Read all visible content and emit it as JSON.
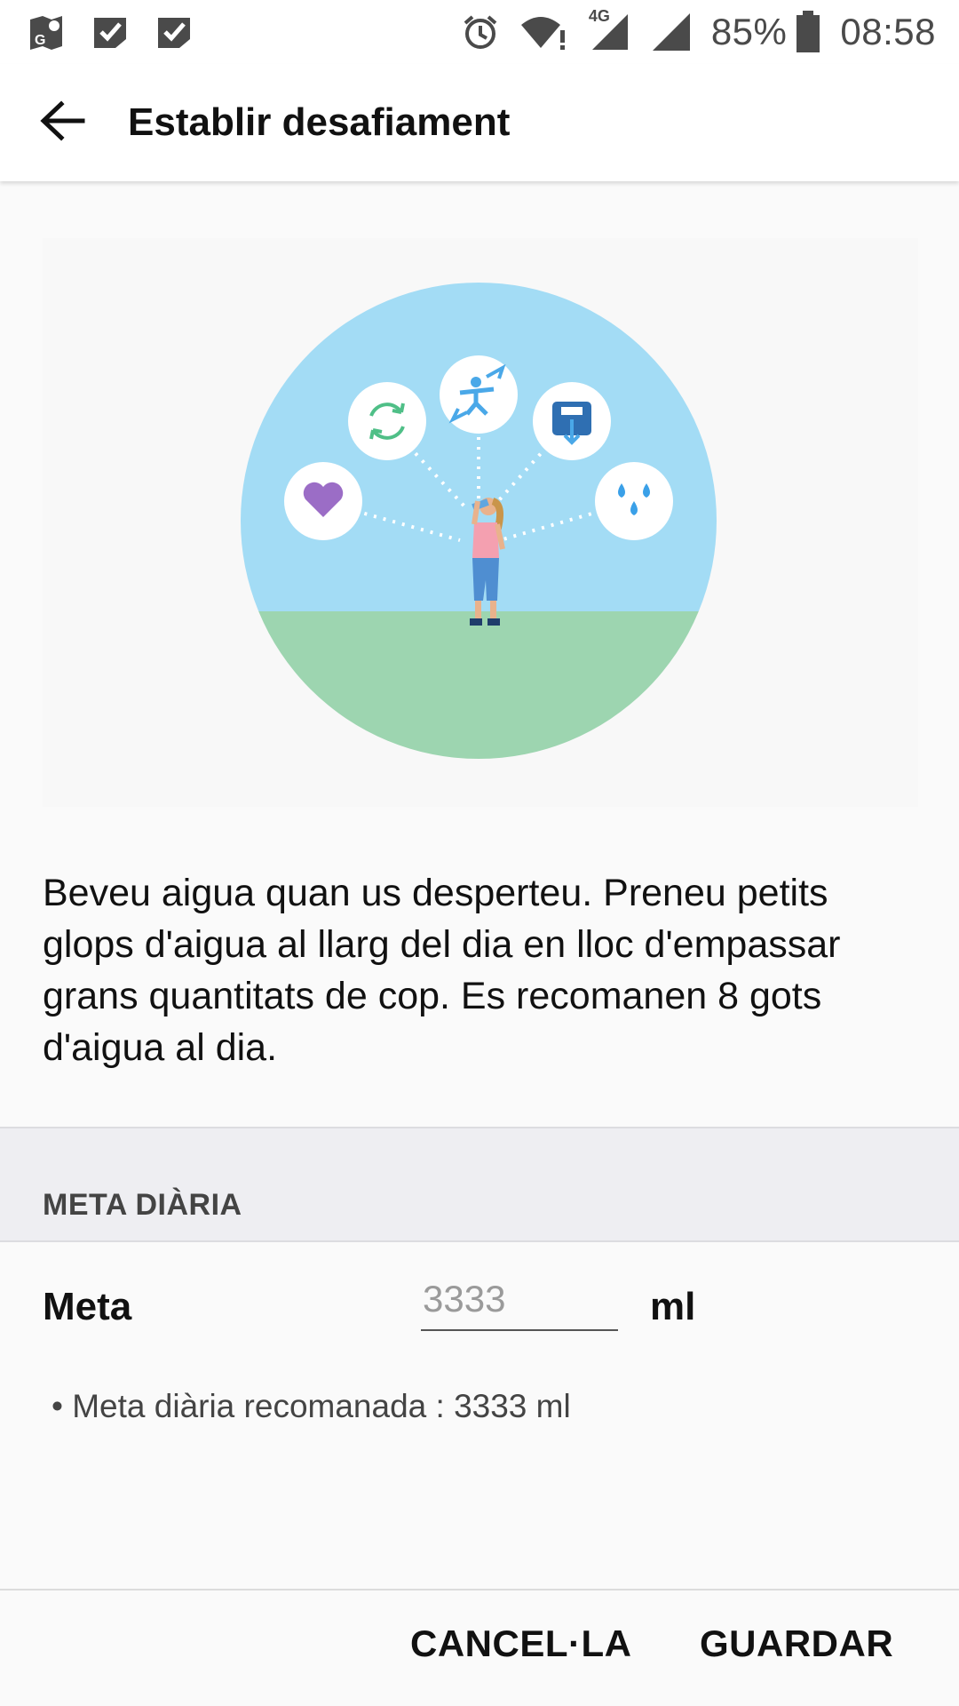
{
  "status_bar": {
    "battery_percent": "85%",
    "time": "08:58",
    "network_type": "4G",
    "icons": [
      "maps-icon",
      "check-icon",
      "check-icon",
      "alarm-icon",
      "wifi-icon",
      "signal-icon",
      "signal-icon",
      "battery-icon"
    ]
  },
  "app_bar": {
    "title": "Establir desafiament",
    "back_icon": "arrow-back-icon"
  },
  "illustration": {
    "icons": [
      "heart-icon",
      "sync-icon",
      "exercise-icon",
      "weight-scale-icon",
      "water-drops-icon"
    ],
    "colors": {
      "sky": "#a3dcf5",
      "grass": "#9dd5b0",
      "heart": "#9b6dc6",
      "sync": "#4fbf87",
      "exercise": "#4aa8e8",
      "scale": "#2f6fb2",
      "water": "#3aa0e8"
    }
  },
  "description": "Beveu aigua quan us desperteu. Preneu petits glops d'aigua al llarg del dia en lloc d'empassar grans quantitats de cop. Es recomanen 8 gots d'aigua al dia.",
  "daily_goal": {
    "section_title": "META DIÀRIA",
    "label": "Meta",
    "placeholder": "3333",
    "value": "",
    "unit": "ml",
    "recommendation": "• Meta diària recomanada : 3333 ml"
  },
  "buttons": {
    "cancel": "CANCEL·LA",
    "save": "GUARDAR"
  }
}
